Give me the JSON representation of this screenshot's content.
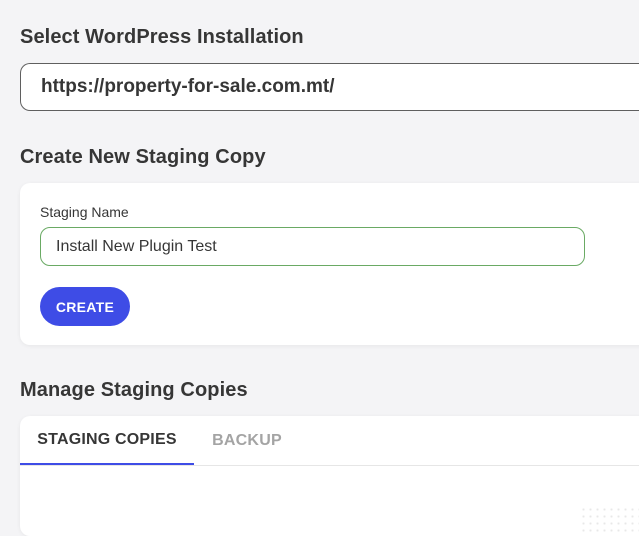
{
  "select_installation": {
    "title": "Select WordPress Installation",
    "selected_value": "https://property-for-sale.com.mt/"
  },
  "create_copy": {
    "title": "Create New Staging Copy",
    "field_label": "Staging Name",
    "field_value": "Install New Plugin Test",
    "button_label": "CREATE"
  },
  "manage_copies": {
    "title": "Manage Staging Copies",
    "tabs": [
      {
        "label": "STAGING COPIES",
        "active": true
      },
      {
        "label": "BACKUP",
        "active": false
      }
    ]
  },
  "colors": {
    "accent": "#3e4ce6",
    "input_border_focus": "#6aaa64",
    "page_background": "#f4f4f6"
  }
}
